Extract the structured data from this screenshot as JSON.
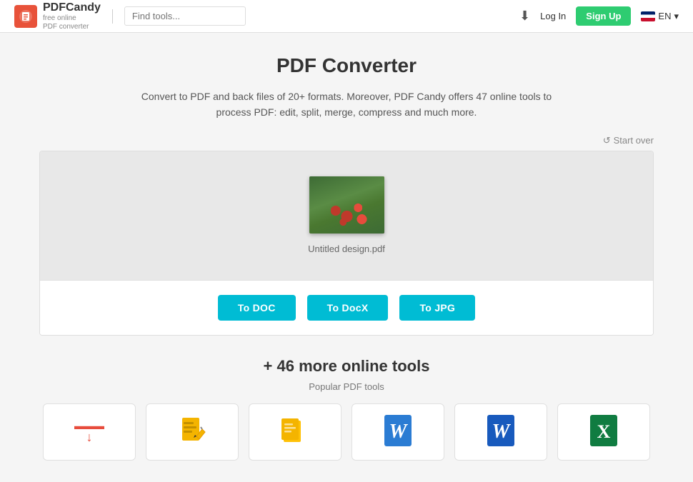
{
  "header": {
    "logo_name": "PDFCandy",
    "logo_sub1": "free online",
    "logo_sub2": "PDF converter",
    "search_placeholder": "Find tools...",
    "download_label": "⬇",
    "login_label": "Log In",
    "signup_label": "Sign Up",
    "lang_label": "EN"
  },
  "start_over": {
    "icon": "↺",
    "label": "Start over"
  },
  "main": {
    "title": "PDF Converter",
    "description_line1": "Convert to PDF and back files of 20+ formats. Moreover, PDF Candy offers 47 online tools to",
    "description_line2": "process PDF: edit, split, merge, compress and much more.",
    "file_name": "Untitled design.pdf",
    "buttons": [
      {
        "id": "to-doc",
        "label": "To DOC"
      },
      {
        "id": "to-docx",
        "label": "To DocX"
      },
      {
        "id": "to-jpg",
        "label": "To JPG"
      }
    ]
  },
  "more_tools": {
    "title": "+ 46 more online tools",
    "popular_label": "Popular PDF tools",
    "tools": [
      {
        "id": "compress-pdf",
        "label": "Compress PDF",
        "icon_type": "compress"
      },
      {
        "id": "edit-pdf",
        "label": "Edit PDF",
        "icon_type": "edit"
      },
      {
        "id": "pdf-to-doc",
        "label": "PDF to DOC",
        "icon_type": "orange-doc"
      },
      {
        "id": "pdf-to-word",
        "label": "PDF to Word",
        "icon_type": "word-blue"
      },
      {
        "id": "pdf-to-word2",
        "label": "PDF to Word",
        "icon_type": "word-blue2"
      },
      {
        "id": "pdf-to-excel",
        "label": "PDF to Excel",
        "icon_type": "excel"
      }
    ]
  }
}
